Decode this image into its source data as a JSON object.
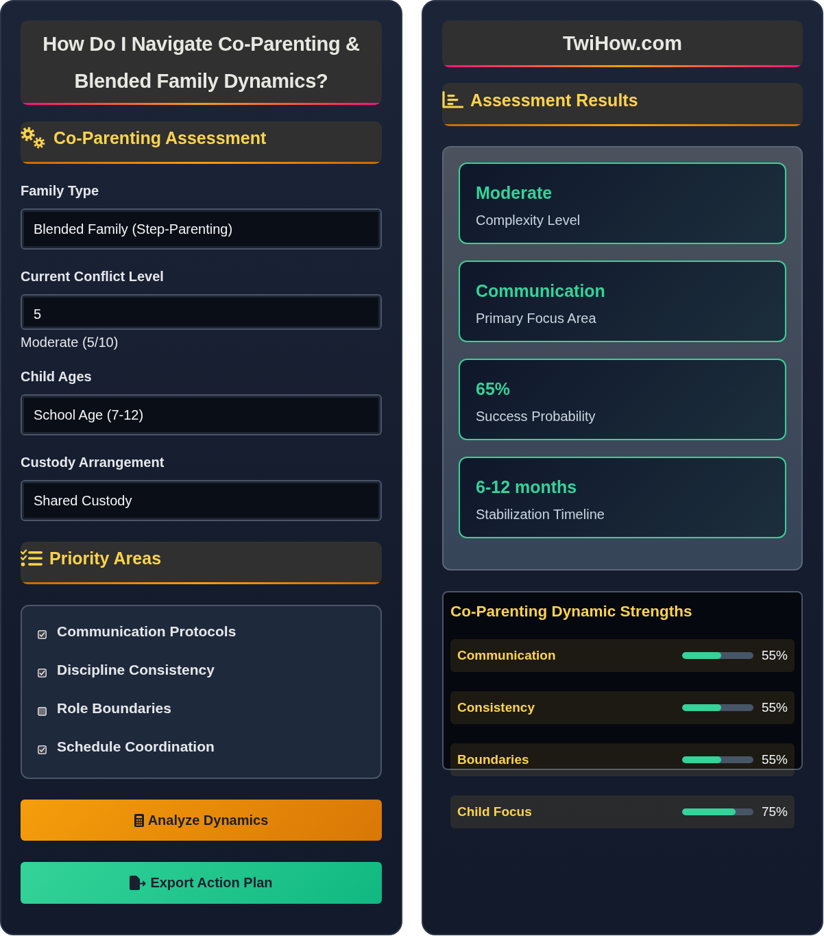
{
  "left": {
    "title": "How Do I Navigate Co-Parenting & Blended Family Dynamics?",
    "assessment": {
      "heading": "Co-Parenting Assessment",
      "fields": [
        {
          "kind": "select",
          "label": "Family Type",
          "value": "Blended Family (Step-Parenting)"
        },
        {
          "kind": "number",
          "label": "Current Conflict Level",
          "value": "5",
          "caption": "Moderate (5/10)"
        },
        {
          "kind": "select",
          "label": "Child Ages",
          "value": "School Age (7-12)"
        },
        {
          "kind": "select",
          "label": "Custody Arrangement",
          "value": "Shared Custody"
        }
      ]
    },
    "priority_areas": {
      "heading": "Priority Areas",
      "items": [
        {
          "label": "Communication Protocols",
          "checked": true
        },
        {
          "label": "Discipline Consistency",
          "checked": true
        },
        {
          "label": "Role Boundaries",
          "checked": false
        },
        {
          "label": "Schedule Coordination",
          "checked": true
        }
      ]
    },
    "buttons": [
      {
        "kind": "analyze",
        "label": "Analyze Dynamics"
      },
      {
        "kind": "export",
        "label": "Export Action Plan"
      }
    ]
  },
  "right": {
    "site": "TwiHow.com",
    "results": {
      "heading": "Assessment Results",
      "cards": [
        {
          "value": "Moderate",
          "label": "Complexity Level"
        },
        {
          "value": "Communication",
          "label": "Primary Focus Area"
        },
        {
          "value": "65%",
          "label": "Success Probability"
        },
        {
          "value": "6-12 months",
          "label": "Stabilization Timeline"
        }
      ]
    },
    "strengths": {
      "title": "Co-Parenting Dynamic Strengths",
      "rows": [
        {
          "label": "Communication",
          "level": 0.55,
          "reading": "55%"
        },
        {
          "label": "Consistency",
          "level": 0.55,
          "reading": "55%"
        },
        {
          "label": "Boundaries",
          "level": 0.55,
          "reading": "55%"
        },
        {
          "label": "Child Focus",
          "level": 0.75,
          "reading": "75%"
        }
      ]
    }
  }
}
